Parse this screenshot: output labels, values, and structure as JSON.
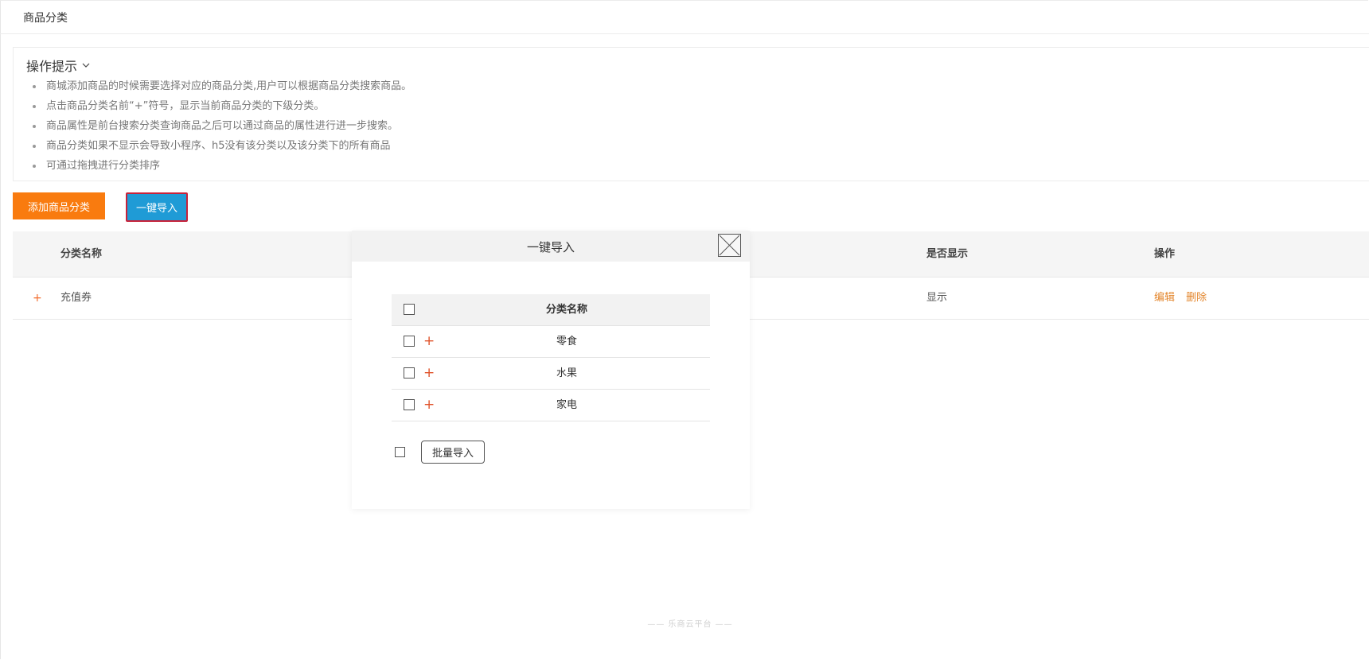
{
  "header": {
    "title": "商品分类"
  },
  "tips": {
    "title": "操作提示",
    "items": [
      "商城添加商品的时候需要选择对应的商品分类,用户可以根据商品分类搜索商品。",
      "点击商品分类名前“+”符号，显示当前商品分类的下级分类。",
      "商品属性是前台搜索分类查询商品之后可以通过商品的属性进行进一步搜索。",
      "商品分类如果不显示会导致小程序、h5没有该分类以及该分类下的所有商品",
      "可通过拖拽进行分类排序"
    ]
  },
  "toolbar": {
    "add_label": "添加商品分类",
    "import_label": "一键导入"
  },
  "table": {
    "columns": {
      "name": "分类名称",
      "show": "是否显示",
      "ops": "操作"
    },
    "rows": [
      {
        "expand": "+",
        "name": "充值券",
        "show": "显示",
        "edit": "编辑",
        "delete": "删除"
      }
    ]
  },
  "modal": {
    "title": "一键导入",
    "column_name": "分类名称",
    "rows": [
      {
        "expand": "+",
        "name": "零食"
      },
      {
        "expand": "+",
        "name": "水果"
      },
      {
        "expand": "+",
        "name": "家电"
      }
    ],
    "batch_label": "批量导入"
  },
  "footer": {
    "text": "—— 乐商云平台 ——"
  },
  "colors": {
    "accent_orange": "#f97b0f",
    "import_blue": "#1f9bd6",
    "highlight_border": "#c8223a",
    "link_orange": "#e3852b"
  }
}
